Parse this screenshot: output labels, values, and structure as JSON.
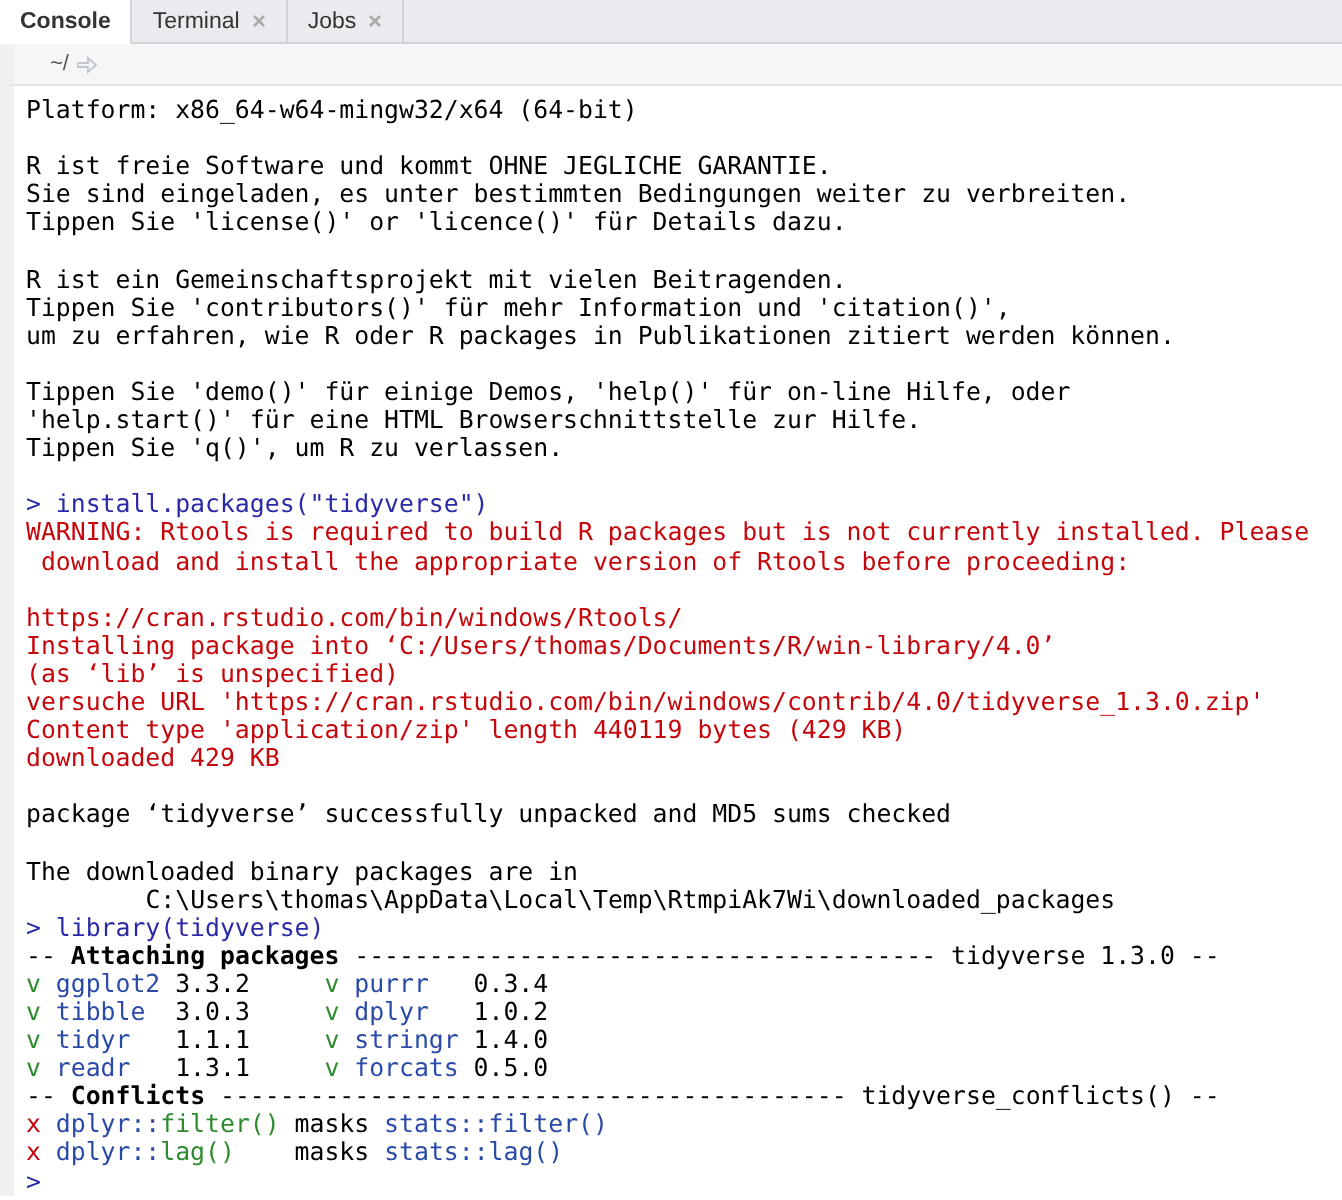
{
  "tabs": [
    {
      "label": "Console",
      "selected": true,
      "closable": false
    },
    {
      "label": "Terminal",
      "selected": false,
      "closable": true
    },
    {
      "label": "Jobs",
      "selected": false,
      "closable": true
    }
  ],
  "path": "~/",
  "lines": [
    {
      "kind": "text",
      "parts": [
        {
          "text": "Platform: x86_64-w64-mingw32/x64 (64-bit)",
          "kind": "plain"
        }
      ]
    },
    {
      "kind": "blank"
    },
    {
      "kind": "text",
      "parts": [
        {
          "text": "R ist freie Software und kommt OHNE JEGLICHE GARANTIE.",
          "kind": "plain"
        }
      ]
    },
    {
      "kind": "text",
      "parts": [
        {
          "text": "Sie sind eingeladen, es unter bestimmten Bedingungen weiter zu verbreiten.",
          "kind": "plain"
        }
      ]
    },
    {
      "kind": "text",
      "parts": [
        {
          "text": "Tippen Sie 'license()' or 'licence()' für Details dazu.",
          "kind": "plain"
        }
      ]
    },
    {
      "kind": "blank"
    },
    {
      "kind": "text",
      "parts": [
        {
          "text": "R ist ein Gemeinschaftsprojekt mit vielen Beitragenden.",
          "kind": "plain"
        }
      ]
    },
    {
      "kind": "text",
      "parts": [
        {
          "text": "Tippen Sie 'contributors()' für mehr Information und 'citation()',",
          "kind": "plain"
        }
      ]
    },
    {
      "kind": "text",
      "parts": [
        {
          "text": "um zu erfahren, wie R oder R packages in Publikationen zitiert werden können.",
          "kind": "plain"
        }
      ]
    },
    {
      "kind": "blank"
    },
    {
      "kind": "text",
      "parts": [
        {
          "text": "Tippen Sie 'demo()' für einige Demos, 'help()' für on-line Hilfe, oder",
          "kind": "plain"
        }
      ]
    },
    {
      "kind": "text",
      "parts": [
        {
          "text": "'help.start()' für eine HTML Browserschnittstelle zur Hilfe.",
          "kind": "plain"
        }
      ]
    },
    {
      "kind": "text",
      "parts": [
        {
          "text": "Tippen Sie 'q()', um R zu verlassen.",
          "kind": "plain"
        }
      ]
    },
    {
      "kind": "blank"
    },
    {
      "kind": "text",
      "parts": [
        {
          "text": "> install.packages(\"tidyverse\")",
          "kind": "input"
        }
      ]
    },
    {
      "kind": "text",
      "parts": [
        {
          "text": "WARNING: Rtools is required to build R packages but is not currently installed. Please",
          "kind": "error"
        }
      ]
    },
    {
      "kind": "text",
      "parts": [
        {
          "text": " download and install the appropriate version of Rtools before proceeding:",
          "kind": "error"
        }
      ]
    },
    {
      "kind": "blank"
    },
    {
      "kind": "text",
      "parts": [
        {
          "text": "https://cran.rstudio.com/bin/windows/Rtools/",
          "kind": "error"
        }
      ]
    },
    {
      "kind": "text",
      "parts": [
        {
          "text": "Installing package into ‘C:/Users/thomas/Documents/R/win-library/4.0’",
          "kind": "error"
        }
      ]
    },
    {
      "kind": "text",
      "parts": [
        {
          "text": "(as ‘lib’ is unspecified)",
          "kind": "error"
        }
      ]
    },
    {
      "kind": "text",
      "parts": [
        {
          "text": "versuche URL 'https://cran.rstudio.com/bin/windows/contrib/4.0/tidyverse_1.3.0.zip'",
          "kind": "error"
        }
      ]
    },
    {
      "kind": "text",
      "parts": [
        {
          "text": "Content type 'application/zip' length 440119 bytes (429 KB)",
          "kind": "error"
        }
      ]
    },
    {
      "kind": "text",
      "parts": [
        {
          "text": "downloaded 429 KB",
          "kind": "error"
        }
      ]
    },
    {
      "kind": "blank"
    },
    {
      "kind": "text",
      "parts": [
        {
          "text": "package ‘tidyverse’ successfully unpacked and MD5 sums checked",
          "kind": "plain"
        }
      ]
    },
    {
      "kind": "blank"
    },
    {
      "kind": "text",
      "parts": [
        {
          "text": "The downloaded binary packages are in",
          "kind": "plain"
        }
      ]
    },
    {
      "kind": "text",
      "parts": [
        {
          "text": "\tC:\\Users\\thomas\\AppData\\Local\\Temp\\RtmpiAk7Wi\\downloaded_packages",
          "kind": "plain"
        }
      ]
    },
    {
      "kind": "text",
      "parts": [
        {
          "text": "> library(tidyverse)",
          "kind": "input"
        }
      ]
    },
    {
      "kind": "text",
      "parts": [
        {
          "text": "-- ",
          "kind": "plain"
        },
        {
          "text": "Attaching packages",
          "kind": "bold"
        },
        {
          "text": " --------------------------------------- tidyverse 1.3.0 --",
          "kind": "plain"
        }
      ]
    },
    {
      "kind": "text",
      "parts": [
        {
          "text": "v ",
          "kind": "green"
        },
        {
          "text": "ggplot2",
          "kind": "blue"
        },
        {
          "text": " 3.3.2     ",
          "kind": "plain"
        },
        {
          "text": "v ",
          "kind": "green"
        },
        {
          "text": "purrr  ",
          "kind": "blue"
        },
        {
          "text": " 0.3.4",
          "kind": "plain"
        }
      ]
    },
    {
      "kind": "text",
      "parts": [
        {
          "text": "v ",
          "kind": "green"
        },
        {
          "text": "tibble ",
          "kind": "blue"
        },
        {
          "text": " 3.0.3     ",
          "kind": "plain"
        },
        {
          "text": "v ",
          "kind": "green"
        },
        {
          "text": "dplyr  ",
          "kind": "blue"
        },
        {
          "text": " 1.0.2",
          "kind": "plain"
        }
      ]
    },
    {
      "kind": "text",
      "parts": [
        {
          "text": "v ",
          "kind": "green"
        },
        {
          "text": "tidyr  ",
          "kind": "blue"
        },
        {
          "text": " 1.1.1     ",
          "kind": "plain"
        },
        {
          "text": "v ",
          "kind": "green"
        },
        {
          "text": "stringr",
          "kind": "blue"
        },
        {
          "text": " 1.4.0",
          "kind": "plain"
        }
      ]
    },
    {
      "kind": "text",
      "parts": [
        {
          "text": "v ",
          "kind": "green"
        },
        {
          "text": "readr  ",
          "kind": "blue"
        },
        {
          "text": " 1.3.1     ",
          "kind": "plain"
        },
        {
          "text": "v ",
          "kind": "green"
        },
        {
          "text": "forcats",
          "kind": "blue"
        },
        {
          "text": " 0.5.0",
          "kind": "plain"
        }
      ]
    },
    {
      "kind": "text",
      "parts": [
        {
          "text": "-- ",
          "kind": "plain"
        },
        {
          "text": "Conflicts",
          "kind": "bold"
        },
        {
          "text": " ------------------------------------------ tidyverse_conflicts() --",
          "kind": "plain"
        }
      ]
    },
    {
      "kind": "text",
      "parts": [
        {
          "text": "x ",
          "kind": "red"
        },
        {
          "text": "dplyr::",
          "kind": "blue"
        },
        {
          "text": "filter()",
          "kind": "green"
        },
        {
          "text": " masks ",
          "kind": "plain"
        },
        {
          "text": "stats::filter()",
          "kind": "blue"
        }
      ]
    },
    {
      "kind": "text",
      "parts": [
        {
          "text": "x ",
          "kind": "red"
        },
        {
          "text": "dplyr::",
          "kind": "blue"
        },
        {
          "text": "lag()",
          "kind": "green"
        },
        {
          "text": "    masks ",
          "kind": "plain"
        },
        {
          "text": "stats::lag()",
          "kind": "blue"
        }
      ]
    },
    {
      "kind": "text",
      "parts": [
        {
          "text": ">",
          "kind": "input"
        }
      ]
    }
  ]
}
